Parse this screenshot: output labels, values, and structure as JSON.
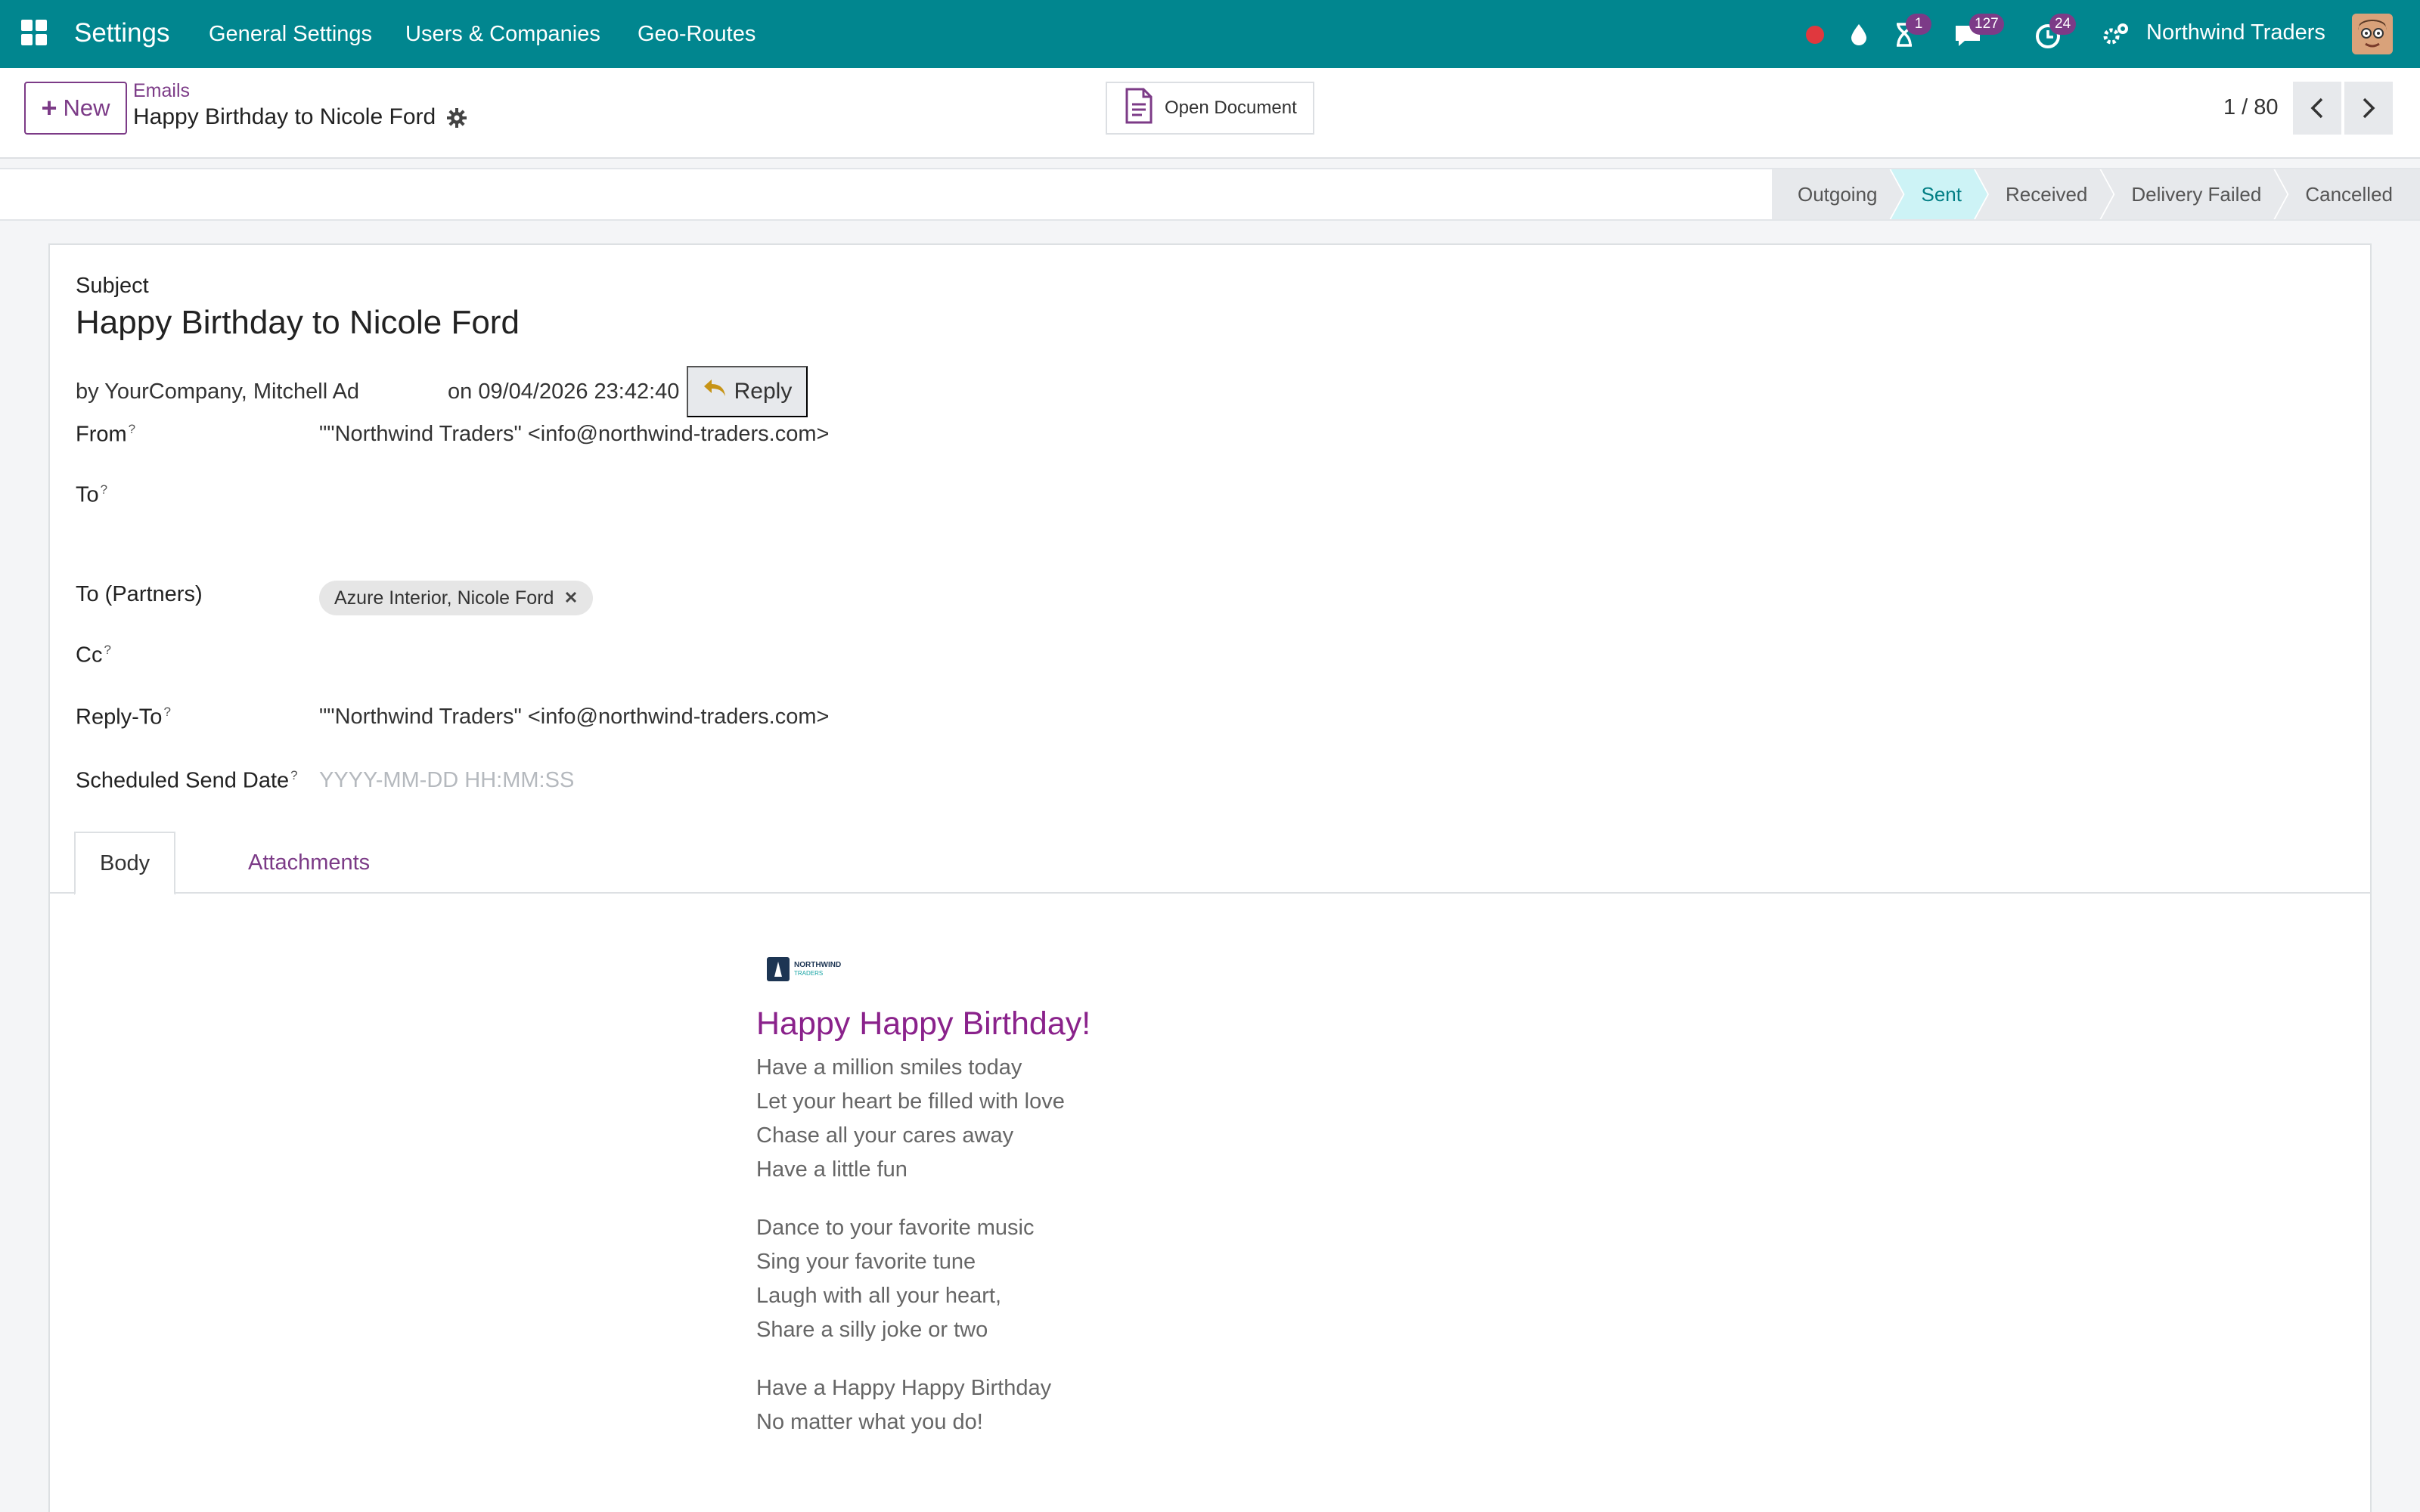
{
  "navbar": {
    "app_name": "Settings",
    "menu": [
      "General Settings",
      "Users & Companies",
      "Geo-Routes"
    ],
    "activity_count": "1",
    "messages_count": "127",
    "clock_count": "24",
    "company": "Northwind Traders",
    "accent_color": "#01868f"
  },
  "control": {
    "new_label": "New",
    "breadcrumb_parent": "Emails",
    "breadcrumb_current": "Happy Birthday to Nicole Ford",
    "open_document_label": "Open Document",
    "pager_text": "1 / 80"
  },
  "stages": [
    {
      "label": "Outgoing",
      "active": false
    },
    {
      "label": "Sent",
      "active": true
    },
    {
      "label": "Received",
      "active": false
    },
    {
      "label": "Delivery Failed",
      "active": false
    },
    {
      "label": "Cancelled",
      "active": false
    }
  ],
  "form": {
    "subject_label": "Subject",
    "subject_value": "Happy Birthday to Nicole Ford",
    "author_line": "by YourCompany, Mitchell Ad",
    "date_line": "on 09/04/2026 23:42:40",
    "reply_label": "Reply",
    "from_label": "From",
    "from_value": "\"\"Northwind Traders\" <info@northwind-traders.com>",
    "to_label": "To",
    "to_value": "",
    "to_partners_label": "To (Partners)",
    "to_partners_tag": "Azure Interior, Nicole Ford",
    "cc_label": "Cc",
    "cc_value": "",
    "reply_to_label": "Reply-To",
    "reply_to_value": "\"\"Northwind Traders\" <info@northwind-traders.com>",
    "scheduled_label": "Scheduled Send Date",
    "scheduled_placeholder": "YYYY-MM-DD HH:MM:SS",
    "help_mark": "?"
  },
  "tabs": {
    "body_label": "Body",
    "attachments_label": "Attachments"
  },
  "email": {
    "logo_name": "NORTHWIND",
    "logo_sub": "TRADERS",
    "title": "Happy Happy Birthday!",
    "stanza1": [
      "Have a million smiles today",
      "Let your heart be filled with love",
      "Chase all your cares away",
      "Have a little fun"
    ],
    "stanza2": [
      "Dance to your favorite music",
      "Sing your favorite tune",
      "Laugh with all your heart,",
      "Share a silly joke or two"
    ],
    "stanza3": [
      "Have a Happy Happy Birthday",
      "No matter what you do!"
    ],
    "title_color": "#8a228b"
  }
}
